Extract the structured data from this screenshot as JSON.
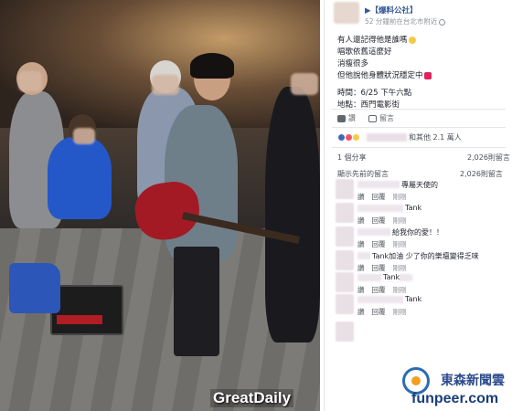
{
  "post": {
    "page_name": "▶【爆料公社】",
    "meta": "52 分鐘前在台北市附近",
    "lines": [
      "有人還記得他是誰嗎",
      "唱歌依舊這麼好",
      "消瘦很多",
      "但他說他身體狀況穩定中"
    ],
    "time_line": "時間：6/25 下午六點",
    "place_line": "地點：西門電影街"
  },
  "actions": {
    "like": "讚",
    "comment": "留言"
  },
  "reactions": {
    "text": "和其他 2.1 萬人"
  },
  "stats": {
    "shares": "1 個分享",
    "share_views": "2,026則留言",
    "comments_label": "顯示先前的留言",
    "comments_count": "2,026則留言"
  },
  "comments": [
    {
      "text": "專屬天使的",
      "actions": [
        "讚",
        "回覆",
        "剛剛"
      ]
    },
    {
      "text": "Tank",
      "actions": [
        "讚",
        "回覆",
        "剛剛"
      ]
    },
    {
      "text": "給我你的愛！！",
      "actions": [
        "讚",
        "回覆",
        "剛剛"
      ]
    },
    {
      "text": "Tank加油 少了你的樂壇變得乏味",
      "actions": [
        "讚",
        "回覆",
        "剛剛"
      ]
    },
    {
      "text": "Tank",
      "actions": [
        "讚",
        "回覆",
        "剛剛"
      ]
    },
    {
      "text": "Tank",
      "actions": [
        "讚",
        "回覆",
        "剛剛"
      ]
    }
  ],
  "watermarks": {
    "left": "GreatDaily",
    "brand": "東森新聞雲",
    "url": "funpeer.com"
  },
  "colors": {
    "link": "#365899",
    "muted": "#90949c",
    "brand_blue": "#2b4a8b"
  }
}
